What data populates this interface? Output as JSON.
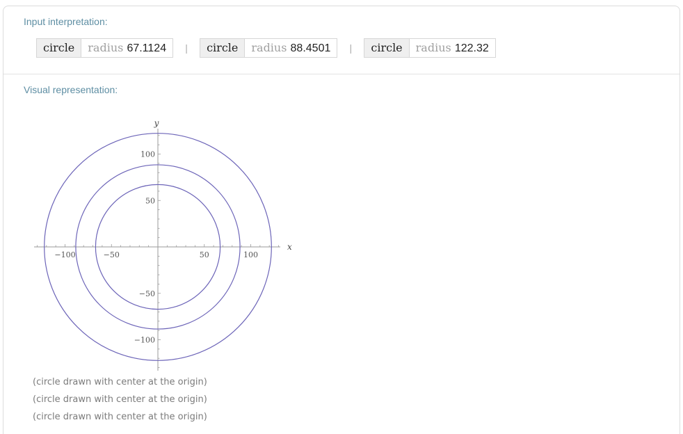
{
  "pods": {
    "input": {
      "title": "Input interpretation:",
      "items": [
        {
          "kind": "circle",
          "param_name": "radius",
          "param_value": "67.1124"
        },
        {
          "kind": "circle",
          "param_name": "radius",
          "param_value": "88.4501"
        },
        {
          "kind": "circle",
          "param_name": "radius",
          "param_value": "122.32"
        }
      ],
      "separator": "|"
    },
    "visual": {
      "title": "Visual representation:",
      "notes": [
        "(circle drawn with center at the origin)",
        "(circle drawn with center at the origin)",
        "(circle drawn with center at the origin)"
      ]
    }
  },
  "chart_data": {
    "type": "line",
    "title": "",
    "xlabel": "x",
    "ylabel": "y",
    "xlim": [
      -135,
      135
    ],
    "ylim": [
      -135,
      135
    ],
    "x_ticks": [
      -100,
      -50,
      50,
      100
    ],
    "y_ticks": [
      100,
      50,
      -50,
      -100
    ],
    "x_tick_labels": [
      "−100",
      "−50",
      "50",
      "100"
    ],
    "y_tick_labels": [
      "100",
      "50",
      "−50",
      "−100"
    ],
    "series": [
      {
        "shape": "circle",
        "center": [
          0,
          0
        ],
        "radius": 67.1124
      },
      {
        "shape": "circle",
        "center": [
          0,
          0
        ],
        "radius": 88.4501
      },
      {
        "shape": "circle",
        "center": [
          0,
          0
        ],
        "radius": 122.32
      }
    ],
    "grid": false,
    "colors": {
      "curve": "#6c64b8",
      "axis": "#9a9a9a"
    }
  }
}
